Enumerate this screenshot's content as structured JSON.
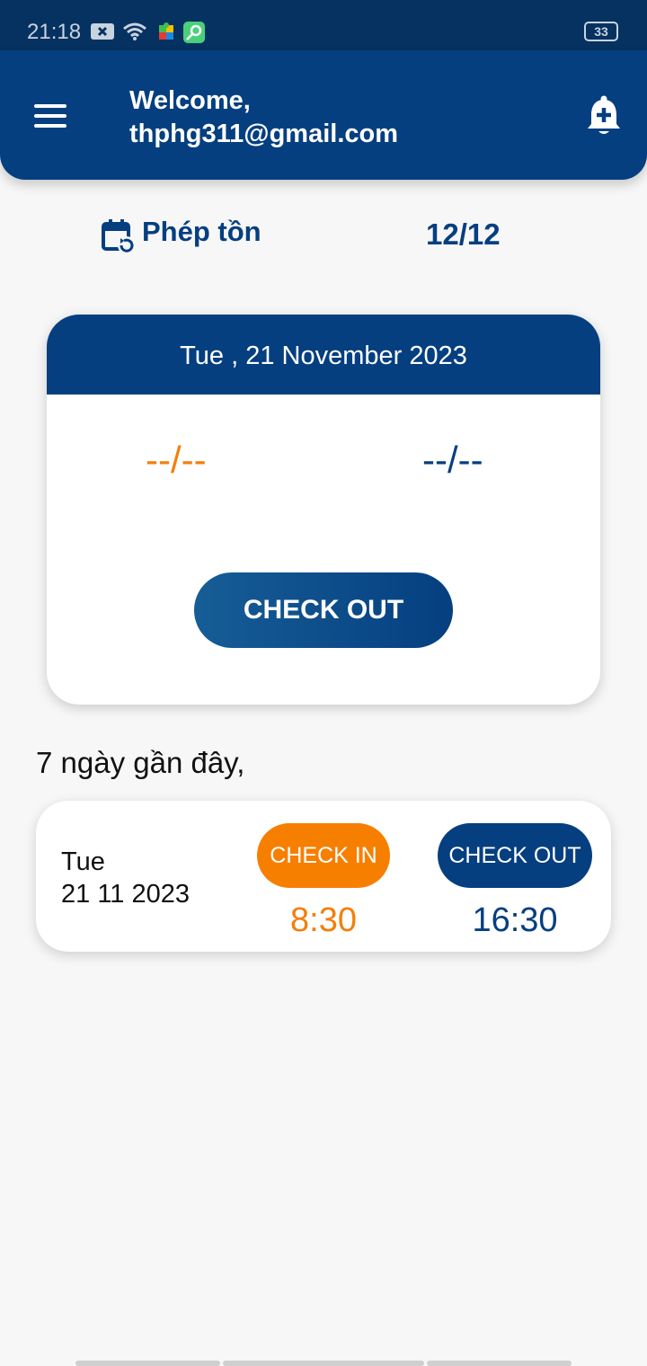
{
  "status_bar": {
    "time": "21:18",
    "battery": "33",
    "icons": [
      "notification-x-icon",
      "wifi-icon",
      "puzzle-app-icon",
      "key-app-icon"
    ]
  },
  "header": {
    "welcome_line1": "Welcome,",
    "welcome_line2": "thphg311@gmail.com",
    "icons": [
      "menu-icon",
      "bell-add-icon"
    ],
    "color": "#053f80"
  },
  "leave": {
    "label": "Phép tồn",
    "value": "12/12",
    "icon": "calendar-refresh-icon"
  },
  "today": {
    "date": "Tue , 21 November 2023",
    "check_in_placeholder": "--/--",
    "check_out_placeholder": "--/--",
    "action_label": "CHECK OUT"
  },
  "recent": {
    "title": "7 ngày gần đây,",
    "entries": [
      {
        "day": "Tue",
        "date": "21 11 2023",
        "check_in_label": "CHECK IN",
        "check_in_time": "8:30",
        "check_out_label": "CHECK OUT",
        "check_out_time": "16:30"
      }
    ]
  },
  "colors": {
    "primary": "#053f80",
    "accent": "#f77f00",
    "background": "#f7f7f7"
  }
}
